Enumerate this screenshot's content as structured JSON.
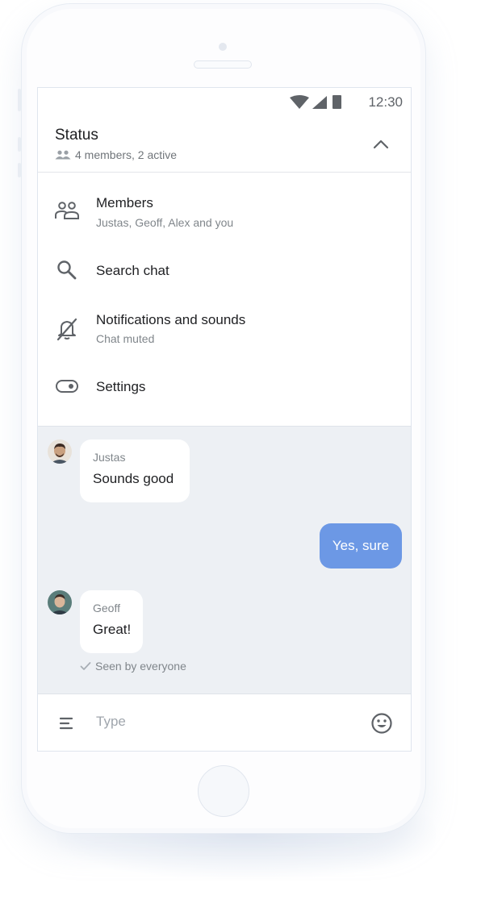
{
  "status_bar": {
    "time": "12:30"
  },
  "header": {
    "title": "Status",
    "subtitle": "4 members, 2 active"
  },
  "menu": {
    "items": [
      {
        "label": "Members",
        "sub": "Justas, Geoff, Alex and you",
        "icon": "members-icon"
      },
      {
        "label": "Search chat",
        "sub": "",
        "icon": "search-icon"
      },
      {
        "label": "Notifications and sounds",
        "sub": "Chat muted",
        "icon": "bell-muted-icon"
      },
      {
        "label": "Settings",
        "sub": "",
        "icon": "toggle-icon"
      }
    ]
  },
  "chat": {
    "messages": [
      {
        "sender": "Justas",
        "text": "Sounds good",
        "direction": "incoming"
      },
      {
        "sender": "",
        "text": "Yes, sure",
        "direction": "outgoing"
      },
      {
        "sender": "Geoff",
        "text": "Great!",
        "direction": "incoming"
      }
    ],
    "seen_text": "Seen by everyone"
  },
  "composer": {
    "placeholder": "Type"
  },
  "colors": {
    "accent": "#6c98e5",
    "chat_background": "#edf0f4",
    "text_primary": "#202124",
    "text_secondary": "#80868b"
  }
}
